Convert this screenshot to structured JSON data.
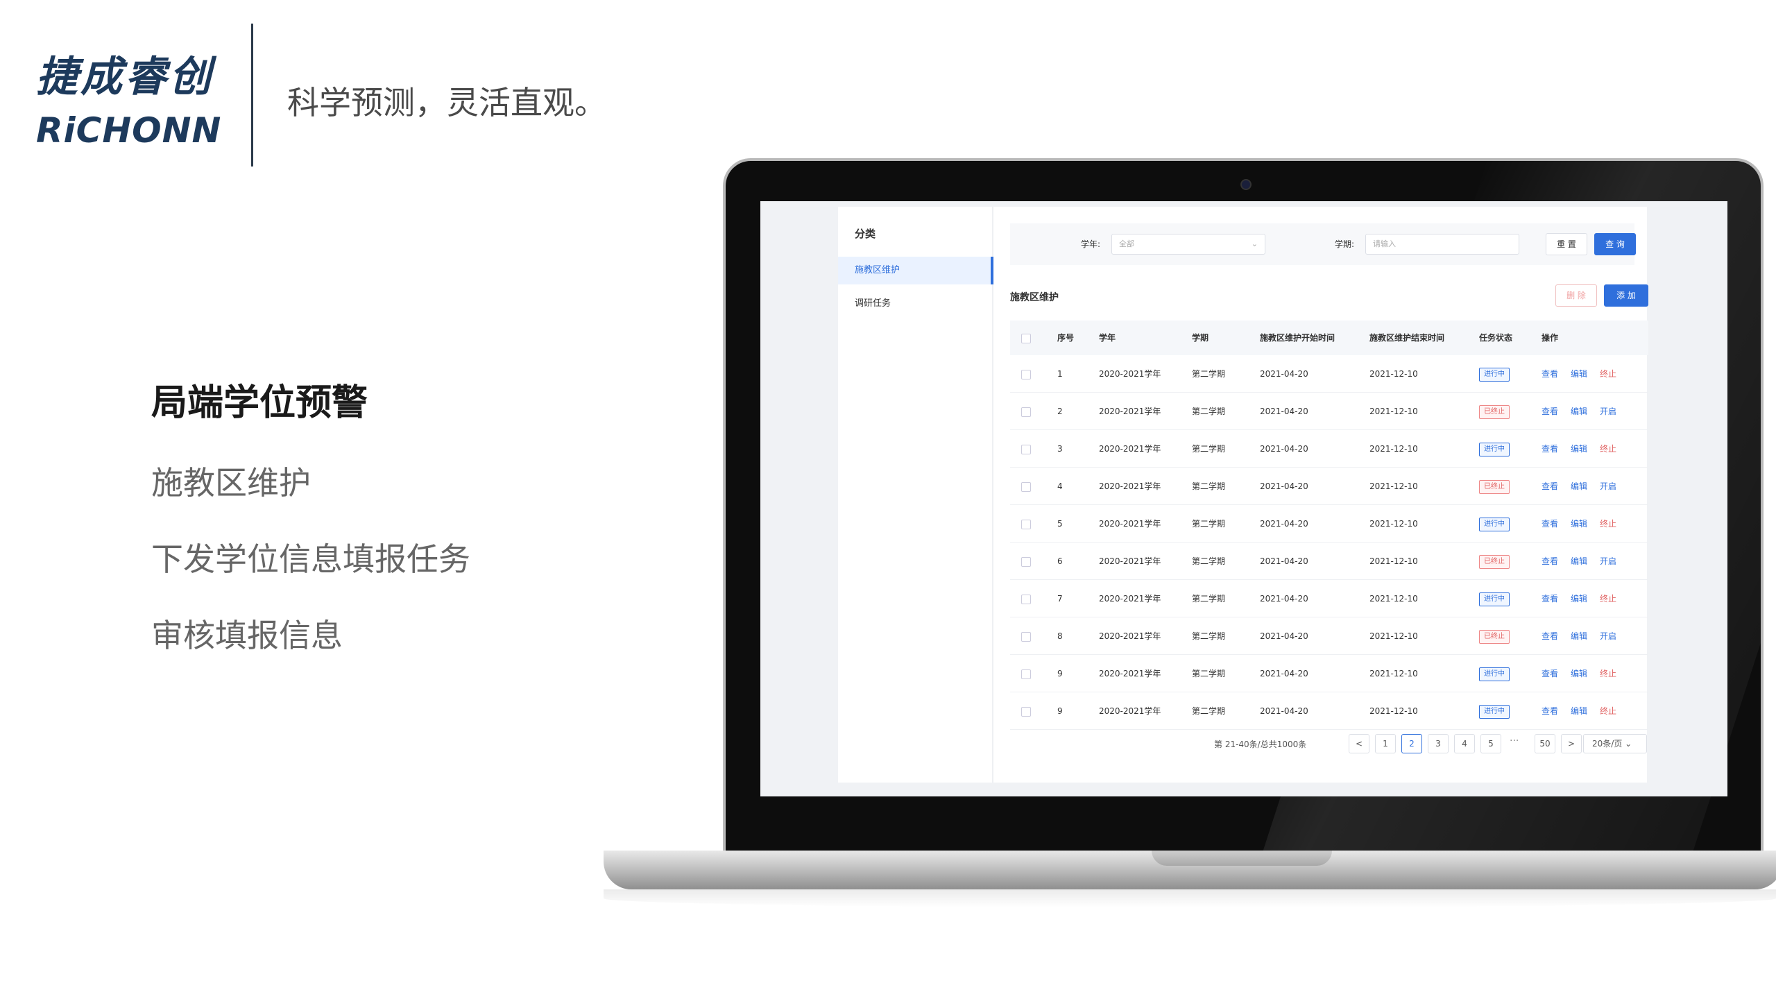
{
  "brand": {
    "logo_cn": "捷成睿创",
    "logo_en": "RiCHONN",
    "tagline": "科学预测，灵活直观。"
  },
  "feature": {
    "title": "局端学位预警",
    "items": [
      "施教区维护",
      "下发学位信息填报任务",
      "审核填报信息"
    ]
  },
  "app": {
    "sidebar": {
      "title": "分类",
      "items": [
        {
          "label": "施教区维护",
          "active": true
        },
        {
          "label": "调研任务",
          "active": false
        }
      ]
    },
    "filters": {
      "year_label": "学年:",
      "year_value": "全部",
      "term_label": "学期:",
      "term_placeholder": "请输入",
      "reset_label": "重 置",
      "query_label": "查 询"
    },
    "section": {
      "title": "施教区维护",
      "delete_label": "删 除",
      "add_label": "添 加"
    },
    "table": {
      "headers": [
        "序号",
        "学年",
        "学期",
        "施教区维护开始时间",
        "施教区维护结束时间",
        "任务状态",
        "操作"
      ],
      "rows": [
        {
          "no": "1",
          "year": "2020-2021学年",
          "term": "第二学期",
          "start": "2021-04-20",
          "end": "2021-12-10",
          "status": "进行中",
          "toggle": "终止"
        },
        {
          "no": "2",
          "year": "2020-2021学年",
          "term": "第二学期",
          "start": "2021-04-20",
          "end": "2021-12-10",
          "status": "已终止",
          "toggle": "开启"
        },
        {
          "no": "3",
          "year": "2020-2021学年",
          "term": "第二学期",
          "start": "2021-04-20",
          "end": "2021-12-10",
          "status": "进行中",
          "toggle": "终止"
        },
        {
          "no": "4",
          "year": "2020-2021学年",
          "term": "第二学期",
          "start": "2021-04-20",
          "end": "2021-12-10",
          "status": "已终止",
          "toggle": "开启"
        },
        {
          "no": "5",
          "year": "2020-2021学年",
          "term": "第二学期",
          "start": "2021-04-20",
          "end": "2021-12-10",
          "status": "进行中",
          "toggle": "终止"
        },
        {
          "no": "6",
          "year": "2020-2021学年",
          "term": "第二学期",
          "start": "2021-04-20",
          "end": "2021-12-10",
          "status": "已终止",
          "toggle": "开启"
        },
        {
          "no": "7",
          "year": "2020-2021学年",
          "term": "第二学期",
          "start": "2021-04-20",
          "end": "2021-12-10",
          "status": "进行中",
          "toggle": "终止"
        },
        {
          "no": "8",
          "year": "2020-2021学年",
          "term": "第二学期",
          "start": "2021-04-20",
          "end": "2021-12-10",
          "status": "已终止",
          "toggle": "开启"
        },
        {
          "no": "9",
          "year": "2020-2021学年",
          "term": "第二学期",
          "start": "2021-04-20",
          "end": "2021-12-10",
          "status": "进行中",
          "toggle": "终止"
        },
        {
          "no": "9",
          "year": "2020-2021学年",
          "term": "第二学期",
          "start": "2021-04-20",
          "end": "2021-12-10",
          "status": "进行中",
          "toggle": "终止"
        }
      ],
      "view_label": "查看",
      "edit_label": "编辑"
    },
    "pagination": {
      "total_text": "第 21-40条/总共1000条",
      "prev": "<",
      "next": ">",
      "pages": [
        "1",
        "2",
        "3",
        "4",
        "5"
      ],
      "current": "2",
      "ellipsis": "···",
      "last": "50",
      "page_size": "20条/页"
    },
    "colors": {
      "primary": "#2f6fdc",
      "danger": "#e06060",
      "brand": "#1d3a5c"
    }
  }
}
